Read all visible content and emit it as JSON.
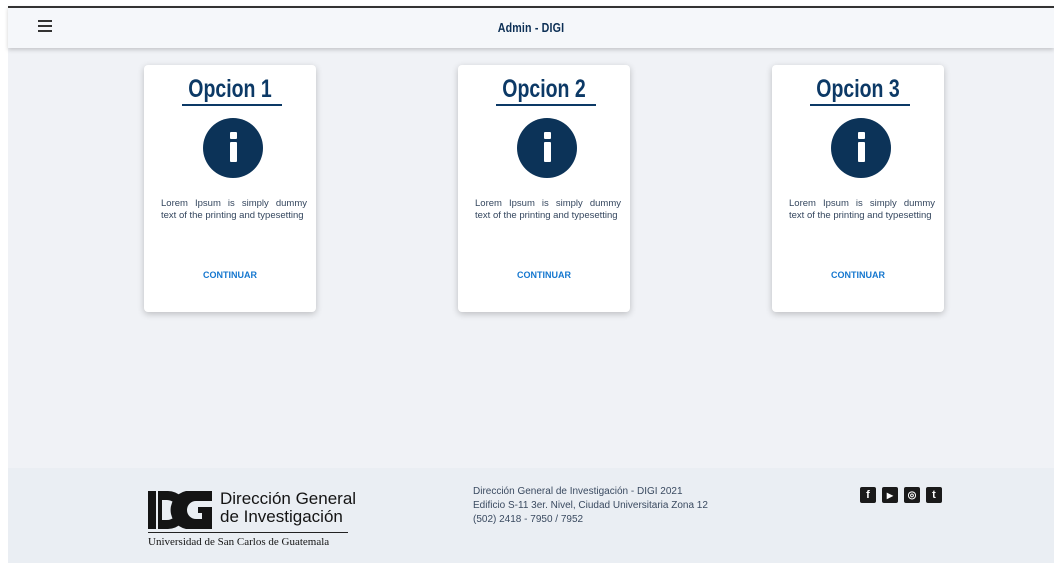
{
  "header": {
    "title": "Admin - DIGI",
    "menu_icon": "hamburger-menu-icon"
  },
  "cards": [
    {
      "title": "Opcion 1",
      "icon": "info-icon",
      "text": "Lorem Ipsum is simply dummy text of the printing and typesetting",
      "button": "CONTINUAR"
    },
    {
      "title": "Opcion 2",
      "icon": "info-icon",
      "text": "Lorem Ipsum is simply dummy text of the printing and typesetting",
      "button": "CONTINUAR"
    },
    {
      "title": "Opcion 3",
      "icon": "info-icon",
      "text": "Lorem Ipsum is simply dummy text of the printing and typesetting",
      "button": "CONTINUAR"
    }
  ],
  "footer": {
    "logo": {
      "line1": "Dirección General",
      "line2": "de Investigación",
      "subtitle": "Universidad de San Carlos de Guatemala"
    },
    "contact": {
      "line1": "Dirección General de Investigación - DIGI 2021",
      "line2": "Edificio S-11 3er. Nivel, Ciudad Universitaria Zona 12",
      "line3": "(502) 2418 - 7950 / 7952"
    },
    "social": [
      {
        "icon": "facebook-icon",
        "glyph": "f"
      },
      {
        "icon": "youtube-icon",
        "glyph": "▶"
      },
      {
        "icon": "instagram-icon",
        "glyph": "◎"
      },
      {
        "icon": "tumblr-icon",
        "glyph": "t"
      }
    ]
  },
  "colors": {
    "primary": "#0c3966",
    "accent": "#1577cf",
    "background": "#f0f2f6"
  }
}
